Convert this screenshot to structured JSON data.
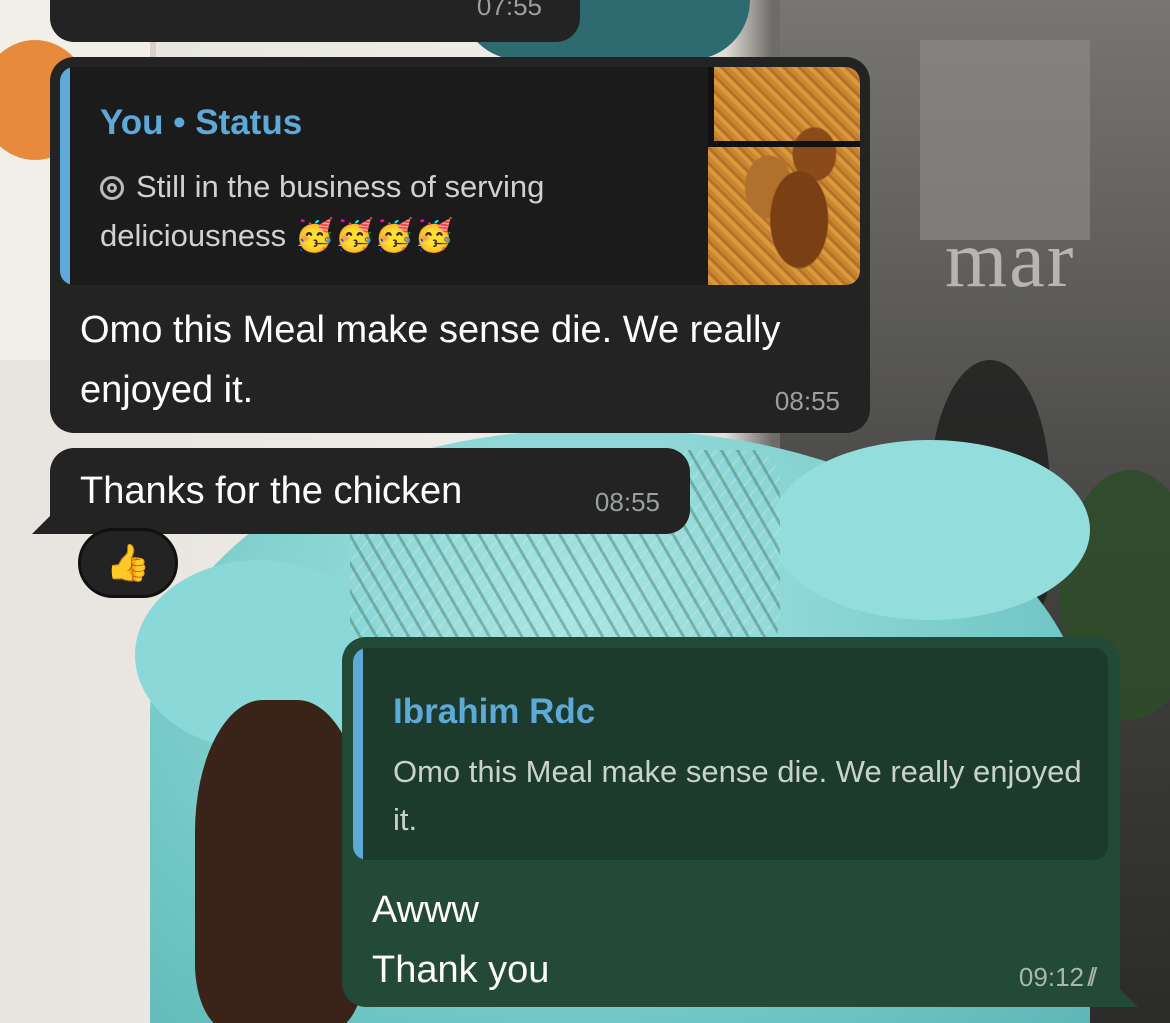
{
  "chat": {
    "partial_top_message": {
      "time": "07:55"
    },
    "msg1": {
      "quote_author": "You • Status",
      "quote_text": "Still in the business of serving deliciousness",
      "quote_emojis": "🥳🥳🥳🥳",
      "text": "Omo this Meal make sense die. We really enjoyed it.",
      "time": "08:55"
    },
    "msg2": {
      "text": "Thanks for the chicken",
      "time": "08:55",
      "reaction": "👍"
    },
    "msg3": {
      "quote_author": "Ibrahim Rdc",
      "quote_text": "Omo this Meal make sense die. We really enjoyed it.",
      "text_line1": "Awww",
      "text_line2": "Thank you",
      "time": "09:12",
      "read_status": "read"
    }
  },
  "icons": {
    "status_icon": "status-ring-icon",
    "read_ticks": "double-check-icon",
    "reaction_icon": "thumbs-up"
  },
  "colors": {
    "incoming_bubble": "#232323",
    "outgoing_bubble": "#234a37",
    "quote_accent": "#5da9d7"
  }
}
